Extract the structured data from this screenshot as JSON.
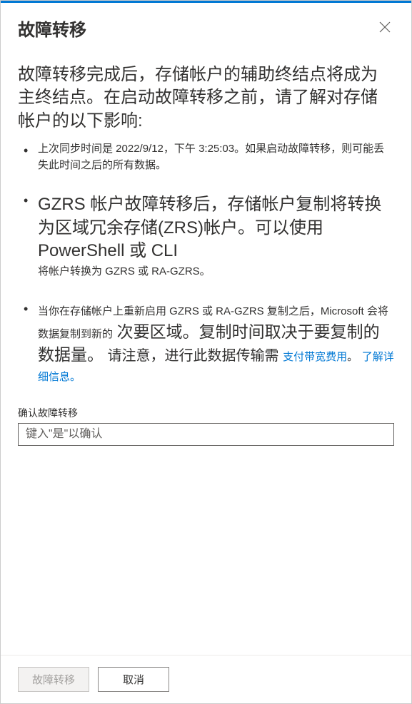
{
  "header": {
    "title": "故障转移"
  },
  "intro": "故障转移完成后，存储帐户的辅助终结点将成为主终结点。在启动故障转移之前，请了解对存储帐户的以下影响:",
  "bullets": {
    "item1": "上次同步时间是 2022/9/12，下午 3:25:03。如果启动故障转移，则可能丢失此时间之后的所有数据。",
    "item2_main": "GZRS 帐户故障转移后，存储帐户复制将转换为区域冗余存储(ZRS)帐户。可以使用 PowerShell 或 CLI",
    "item2_sub": "将帐户转换为 GZRS 或 RA-GZRS。",
    "item3_part1": "当你在存储帐户上重新启用 GZRS 或 RA-GZRS 复制之后，Microsoft 会将数据复制到新的",
    "item3_part2": "次要区域。复制时间取决于要复制的数据量。",
    "item3_part3": "请注意，进行此数据传输需",
    "item3_link1": "支付带宽费用",
    "item3_sep": "。",
    "item3_link2": "了解详细信息。"
  },
  "confirm": {
    "label": "确认故障转移",
    "placeholder": "键入\"是\"以确认"
  },
  "footer": {
    "primary": "故障转移",
    "secondary": "取消"
  }
}
